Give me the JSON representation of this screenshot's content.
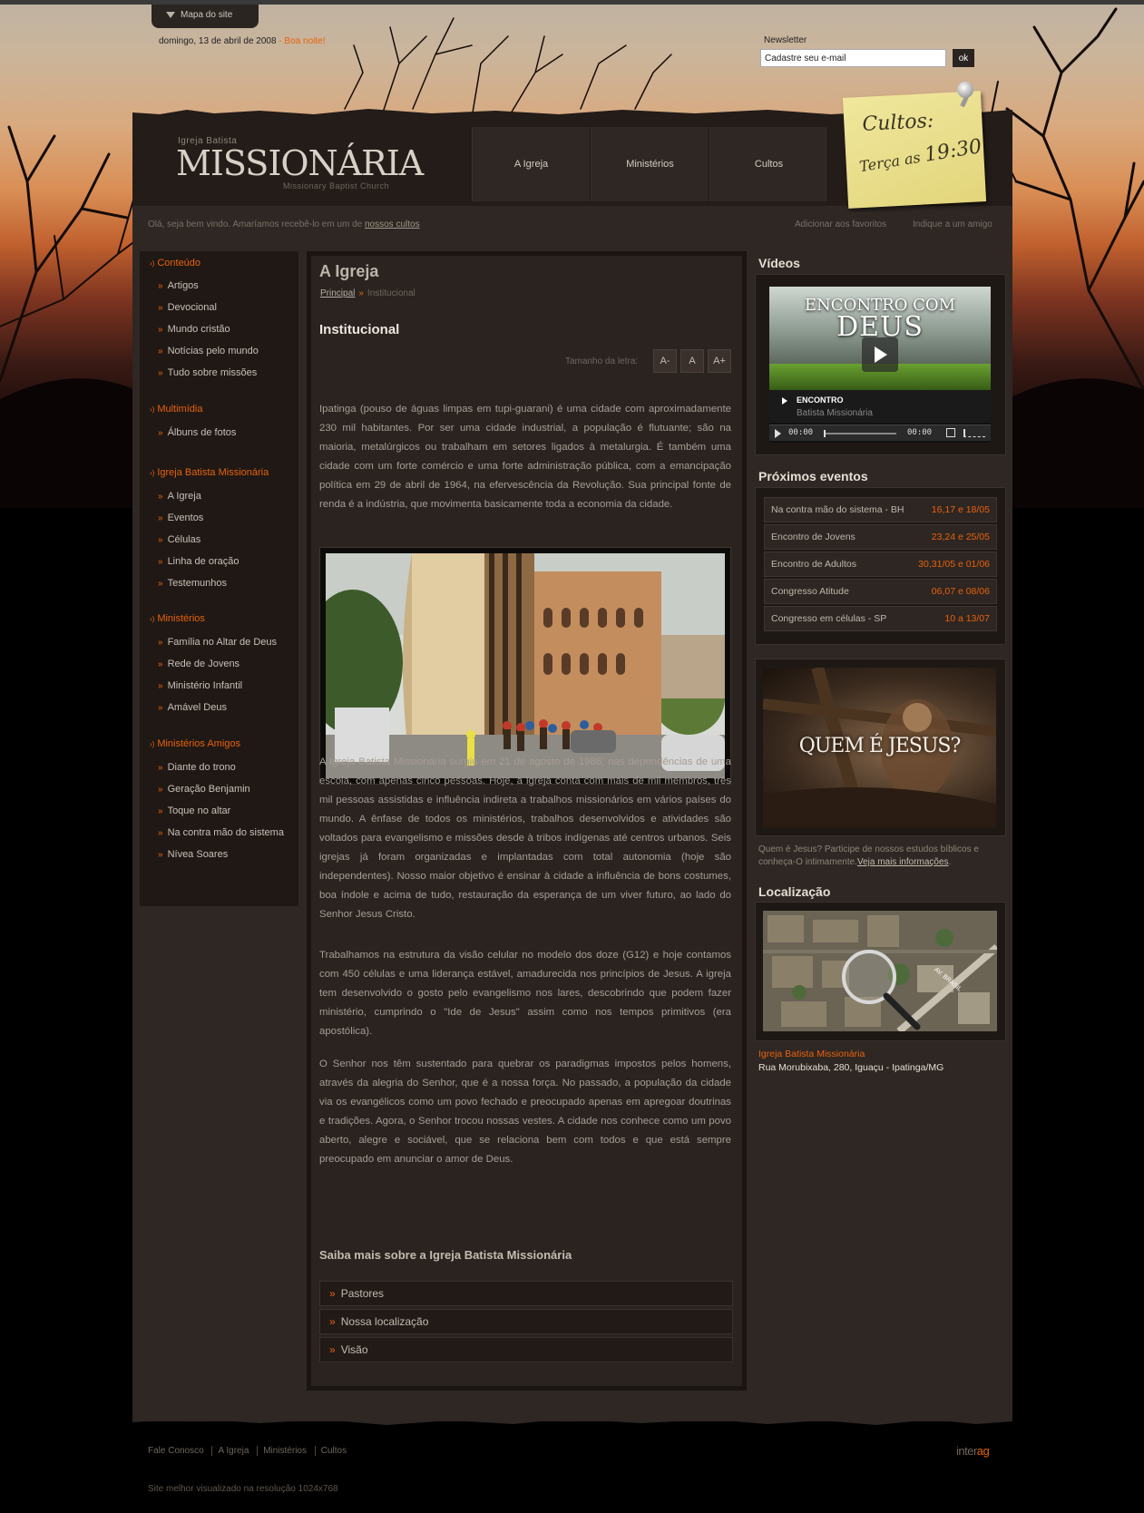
{
  "top": {
    "sitemap_label": "Mapa do site",
    "date": "domingo, 13 de abril de 2008",
    "greeting": "- Boa noite!",
    "newsletter_label": "Newsletter",
    "newsletter_placeholder": "Cadastre seu e-mail",
    "newsletter_button": "ok"
  },
  "logo": {
    "line1": "Igreja Batista",
    "line2": "MISSIONÁRIA",
    "line3": "Missionary Baptist Church"
  },
  "nav": [
    "A Igreja",
    "Ministérios",
    "Cultos"
  ],
  "postit": {
    "line1": "Cultos:",
    "line2": "Terça as",
    "time": "19:30"
  },
  "welcome": {
    "text": "Olá, seja bem vindo. Amaríamos recebê-lo em um de ",
    "link": "nossos cultos",
    "favorites": "Adicionar aos favoritos",
    "indicate": "Indique a um amigo"
  },
  "sidebar": {
    "sections": [
      {
        "title": "Conteúdo",
        "items": [
          "Artigos",
          "Devocional",
          "Mundo cristão",
          "Notícias pelo mundo",
          "Tudo sobre missões"
        ]
      },
      {
        "title": "Multimídia",
        "items": [
          "Álbuns de fotos"
        ]
      },
      {
        "title": "Igreja Batista Missionária",
        "items": [
          "A Igreja",
          "Eventos",
          "Células",
          "Linha de oração",
          "Testemunhos"
        ]
      },
      {
        "title": "Ministérios",
        "items": [
          "Família no Altar de Deus",
          "Rede de Jovens",
          "Ministério Infantil",
          "Amável Deus"
        ]
      },
      {
        "title": "Ministérios Amigos",
        "items": [
          "Diante do trono",
          "Geração Benjamin",
          "Toque no altar",
          "Na contra mão do sistema",
          "Nívea Soares"
        ]
      }
    ]
  },
  "content": {
    "title": "A Igreja",
    "breadcrumb_home": "Principal",
    "breadcrumb_current": "Institucional",
    "subtitle": "Institucional",
    "font_size_label": "Tamanho da letra:",
    "font_buttons": [
      "A-",
      "A",
      "A+"
    ],
    "paragraphs": [
      "Ipatinga (pouso de águas limpas em tupi-guarani) é uma cidade com aproximadamente 230 mil habitantes. Por ser uma cidade industrial, a população é flutuante; são na maioria, metalúrgicos ou trabalham em setores ligados à metalurgia. É também uma cidade com um forte comércio e uma forte administração pública, com a emancipação política em 29 de abril de 1964, na efervescência da Revolução. Sua principal fonte de renda é a indústria, que movimenta basicamente toda a economia da cidade.",
      "A Igreja Batista Missionária surgiu em 21 de agosto de 1986, nas dependências de uma escola, com apenas cinco pessoas. Hoje, a igreja conta com mais de mil membros, três mil pessoas assistidas e influência indireta a trabalhos missionários em vários países do mundo. A ênfase de todos os ministérios, trabalhos desenvolvidos e atividades são voltados para evangelismo e missões desde à tribos indígenas até centros urbanos. Seis igrejas já foram organizadas e implantadas com total autonomia (hoje são independentes). Nosso maior objetivo é ensinar à cidade a influência de bons costumes, boa índole e acima de tudo, restauração da esperança de um viver futuro, ao lado do Senhor Jesus Cristo.",
      "Trabalhamos na estrutura da visão celular no modelo dos doze (G12) e hoje contamos com 450 células e uma liderança estável, amadurecida nos princípios de Jesus. A igreja tem desenvolvido o gosto pelo evangelismo nos lares, descobrindo que podem fazer ministério, cumprindo o \"Ide de Jesus\" assim como nos tempos primitivos (era apostólica).",
      "O Senhor nos têm sustentado para quebrar os paradigmas impostos pelos homens, através da alegria do Senhor, que é a nossa força. No passado, a população da cidade via os evangélicos como um povo fechado e preocupado apenas em apregoar doutrinas e tradições. Agora, o Senhor trocou nossas vestes. A cidade nos conhece como um povo aberto, alegre e sociável, que se relaciona bem com todos e que está sempre preocupado em anunciar o amor de Deus."
    ],
    "more_title": "Saiba mais sobre a Igreja Batista Missionária",
    "more_links": [
      "Pastores",
      "Nossa localização",
      "Visão"
    ]
  },
  "right": {
    "videos_title": "Vídeos",
    "video": {
      "line1": "ENCONTRO COM",
      "line2": "DEUS",
      "info_title": "ENCONTRO",
      "info_sub": "Batista Missionária",
      "time_current": "00:00",
      "time_total": "00:00"
    },
    "events_title": "Próximos eventos",
    "events": [
      {
        "name": "Na contra mão do sistema - BH",
        "date": "16,17 e 18/05"
      },
      {
        "name": "Encontro de Jovens",
        "date": "23,24 e 25/05"
      },
      {
        "name": "Encontro de Adultos",
        "date": "30,31/05 e 01/06"
      },
      {
        "name": "Congresso Atitude",
        "date": "06,07 e 08/06"
      },
      {
        "name": "Congresso em células - SP",
        "date": "10 a 13/07"
      }
    ],
    "jesus_banner": "QUEM É JESUS?",
    "jesus_desc": "Quem é Jesus? Participe de nossos estudos bíblicos e conheça-O intimamente.",
    "jesus_link": "Veja mais informações",
    "location_title": "Localização",
    "map_label": "AV. BRASIL",
    "location_name": "Igreja Batista Missionária",
    "location_address": "Rua Morubixaba, 280, Iguaçu - Ipatinga/MG"
  },
  "footer": {
    "links": [
      "Fale Conosco",
      "A Igreja",
      "Ministérios",
      "Cultos"
    ],
    "note": "Site melhor visualizado na resolução 1024x768",
    "brand_a": "inter",
    "brand_b": "ag"
  },
  "colors": {
    "accent": "#e8620c",
    "background": "#2e2723",
    "panel": "#1f1815"
  }
}
